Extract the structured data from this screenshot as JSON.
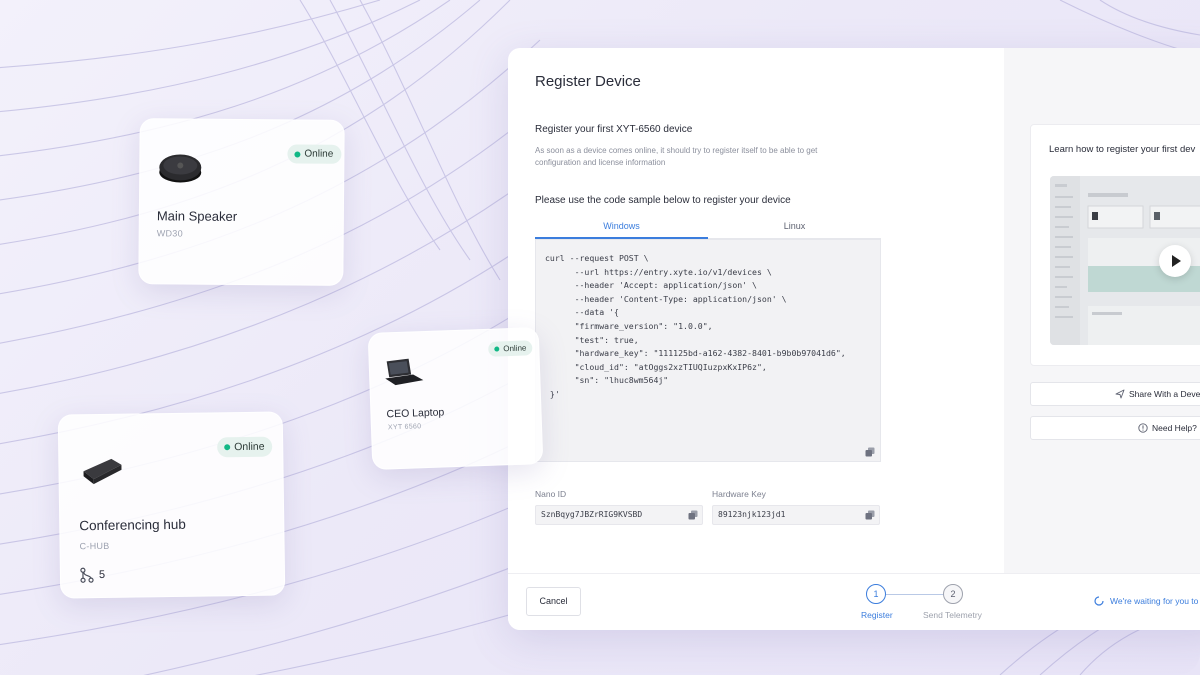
{
  "devices": [
    {
      "name": "Main Speaker",
      "model": "WD30",
      "status": "Online"
    },
    {
      "name": "CEO Laptop",
      "model": "XYT 6560",
      "status": "Online"
    },
    {
      "name": "Conferencing hub",
      "model": "C-HUB",
      "status": "Online",
      "connections": "5"
    }
  ],
  "register": {
    "title": "Register Device",
    "subtitle": "Register your first XYT-6560 device",
    "description": "As soon as a device comes online, it should try to register itself to be able to get configuration and license information",
    "code_heading": "Please use the code sample below to register your device",
    "tabs": [
      {
        "label": "Windows",
        "active": true
      },
      {
        "label": "Linux",
        "active": false
      }
    ],
    "code": "curl --request POST \\\n      --url https://entry.xyte.io/v1/devices \\\n      --header 'Accept: application/json' \\\n      --header 'Content-Type: application/json' \\\n      --data '{\n      \"firmware_version\": \"1.0.0\",\n      \"test\": true,\n      \"hardware_key\": \"111125bd-a162-4382-8401-b9b0b97041d6\",\n      \"cloud_id\": \"atOggs2xzTIUQIuzpxKxIP6z\",\n      \"sn\": \"lhuc8wm564j\"\n }'",
    "nano_id_label": "Nano ID",
    "nano_id_value": "SznBqyg7JBZrRIG9KVSBD",
    "hardware_key_label": "Hardware Key",
    "hardware_key_value": "89123njk123jd1"
  },
  "footer": {
    "cancel_label": "Cancel",
    "steps": [
      {
        "number": "1",
        "label": "Register",
        "active": true
      },
      {
        "number": "2",
        "label": "Send Telemetry",
        "active": false
      }
    ],
    "waiting_text": "We're waiting for you to"
  },
  "sidebar": {
    "learn_title": "Learn how to register your first dev",
    "share_label": "Share With a Devel",
    "help_label": "Need Help?"
  },
  "colors": {
    "accent": "#3b7ddd",
    "online": "#12b886"
  }
}
